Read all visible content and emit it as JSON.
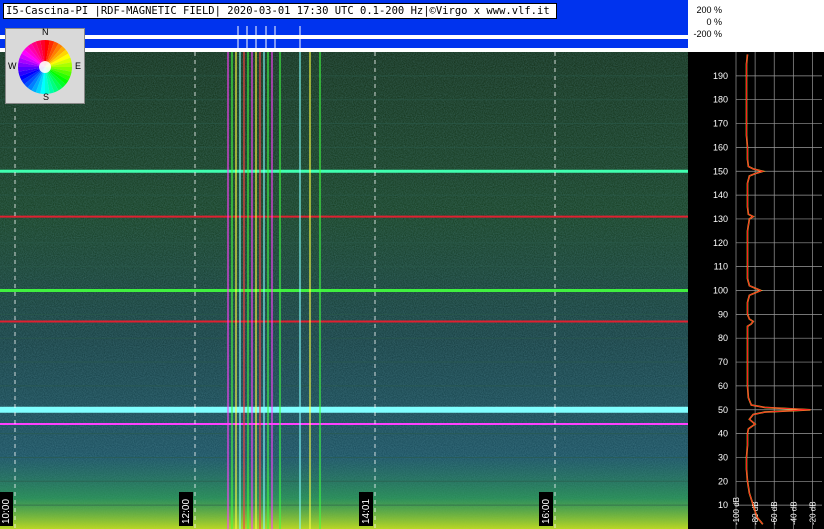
{
  "header": {
    "title": "I5-Cascina-PI |RDF-MAGNETIC FIELD| 2020-03-01 17:30 UTC 0.1-200 Hz|©Virgo x www.vlf.it",
    "amplitude_labels": [
      "200 %",
      "0 %",
      "-200 %"
    ]
  },
  "compass": {
    "north": "N",
    "south": "S",
    "east": "E",
    "west": "W"
  },
  "colors": {
    "header_bg": "#0033ee",
    "spectrum_bg": "#000000",
    "spectrum_grid": "#9a9a9a",
    "spectrum_red": "#ff2020",
    "spectrum_yellow": "#ffff40",
    "time_grid": "#ffffff"
  },
  "chart_data": [
    {
      "type": "heatmap",
      "title": "I5-Cascina-PI |RDF-MAGNETIC FIELD| 2020-03-01 17:30 UTC 0.1-200 Hz|©Virgo x www.vlf.it",
      "x_tick_labels": [
        "10:00",
        "12:00",
        "14:01",
        "16:00"
      ],
      "y_tick_labels": [
        "10",
        "20",
        "30",
        "40",
        "50",
        "60",
        "70",
        "80",
        "90",
        "100",
        "110",
        "120",
        "130",
        "140",
        "150",
        "160",
        "170",
        "180",
        "190"
      ],
      "y_unit": "Hz",
      "ylim": [
        0,
        200
      ],
      "grid": true,
      "horizontal_lines_hz": [
        {
          "freq": 150,
          "color": "cyan-green"
        },
        {
          "freq": 131,
          "color": "red"
        },
        {
          "freq": 100,
          "color": "green"
        },
        {
          "freq": 87,
          "color": "red"
        },
        {
          "freq": 50,
          "color": "cyan"
        },
        {
          "freq": 44,
          "color": "magenta"
        }
      ]
    },
    {
      "type": "line",
      "x_tick_labels": [
        "-100 dB",
        "-80 dB",
        "-60 dB",
        "-40 dB",
        "-20 dB"
      ],
      "xlim": [
        -100,
        -10
      ],
      "y_tick_labels": [
        "10",
        "20",
        "30",
        "40",
        "50",
        "60",
        "70",
        "80",
        "90",
        "100",
        "110",
        "120",
        "130",
        "140",
        "150",
        "160",
        "170",
        "180",
        "190"
      ],
      "ylim": [
        0,
        200
      ],
      "grid": true,
      "series": [
        {
          "color": "red",
          "freq": [
            2,
            5,
            10,
            15,
            20,
            25,
            30,
            35,
            40,
            42,
            44,
            46,
            48,
            49,
            50,
            51,
            52,
            55,
            60,
            65,
            70,
            75,
            80,
            85,
            86,
            87,
            88,
            90,
            95,
            98,
            99,
            100,
            101,
            102,
            105,
            110,
            115,
            120,
            125,
            130,
            131,
            132,
            135,
            140,
            145,
            148,
            149,
            150,
            151,
            152,
            155,
            160,
            165,
            170,
            175,
            180,
            185,
            190,
            195,
            199
          ],
          "db": [
            -72,
            -78,
            -82,
            -86,
            -88,
            -89,
            -89,
            -88,
            -88,
            -87,
            -80,
            -86,
            -82,
            -70,
            -22,
            -70,
            -84,
            -87,
            -88,
            -88,
            -88,
            -88,
            -88,
            -88,
            -84,
            -82,
            -86,
            -88,
            -88,
            -86,
            -80,
            -74,
            -80,
            -86,
            -88,
            -88,
            -88,
            -88,
            -88,
            -86,
            -82,
            -87,
            -88,
            -88,
            -88,
            -86,
            -80,
            -72,
            -82,
            -87,
            -88,
            -88,
            -89,
            -89,
            -89,
            -89,
            -89,
            -89,
            -89,
            -88
          ]
        }
      ]
    }
  ]
}
